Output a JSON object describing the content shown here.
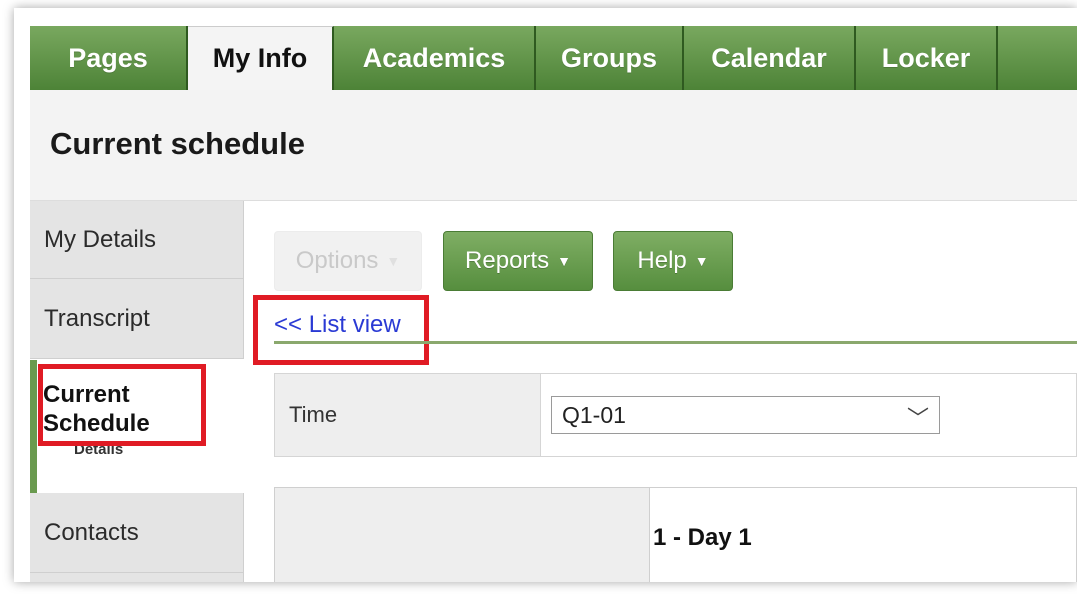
{
  "tabs": [
    {
      "label": "Pages"
    },
    {
      "label": "My Info"
    },
    {
      "label": "Academics"
    },
    {
      "label": "Groups"
    },
    {
      "label": "Calendar"
    },
    {
      "label": "Locker"
    }
  ],
  "page": {
    "title": "Current schedule"
  },
  "sidebar": {
    "my_details": "My Details",
    "transcript": "Transcript",
    "current_line1": "Current",
    "current_line2": "Schedule",
    "current_sub": "Details",
    "contacts": "Contacts"
  },
  "toolbar": {
    "options_label": "Options",
    "reports_label": "Reports",
    "help_label": "Help"
  },
  "list_view_link": "<< List view",
  "time_filter": {
    "label": "Time",
    "selected": "Q1-01"
  },
  "schedule_grid": {
    "column_header": "1 - Day 1"
  },
  "colors": {
    "tab_green": "#5a9142",
    "active_tab_bg": "#f4f4f4",
    "highlight_red": "#e01b24",
    "link_blue": "#2a3ad4"
  }
}
